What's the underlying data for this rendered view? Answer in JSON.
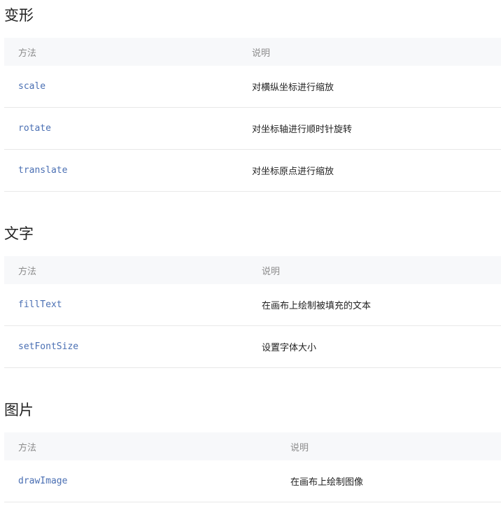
{
  "sections": [
    {
      "title": "变形",
      "header": {
        "method": "方法",
        "desc": "说明"
      },
      "rows": [
        {
          "method": "scale",
          "desc": "对横纵坐标进行缩放"
        },
        {
          "method": "rotate",
          "desc": "对坐标轴进行顺时针旋转"
        },
        {
          "method": "translate",
          "desc": "对坐标原点进行缩放"
        }
      ]
    },
    {
      "title": "文字",
      "header": {
        "method": "方法",
        "desc": "说明"
      },
      "rows": [
        {
          "method": "fillText",
          "desc": "在画布上绘制被填充的文本"
        },
        {
          "method": "setFontSize",
          "desc": "设置字体大小"
        }
      ]
    },
    {
      "title": "图片",
      "header": {
        "method": "方法",
        "desc": "说明"
      },
      "rows": [
        {
          "method": "drawImage",
          "desc": "在画布上绘制图像"
        }
      ]
    }
  ]
}
